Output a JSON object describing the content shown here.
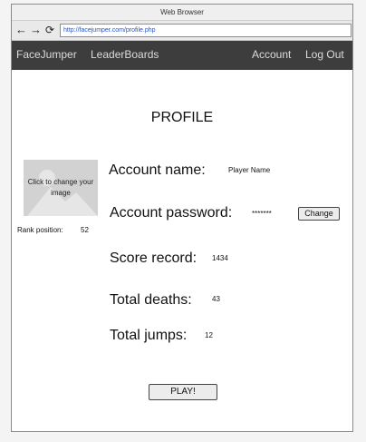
{
  "window": {
    "title": "Web Browser",
    "url": "http://facejumper.com/profile.php"
  },
  "nav": {
    "brand": "FaceJumper",
    "leaderboards": "LeaderBoards",
    "account": "Account",
    "logout": "Log Out"
  },
  "page": {
    "title": "PROFILE"
  },
  "avatar": {
    "prompt": "Click to change your image"
  },
  "rank": {
    "label": "Rank position:",
    "value": "52"
  },
  "fields": {
    "account_name_label": "Account name:",
    "account_name_value": "Player Name",
    "password_label": "Account password:",
    "password_value": "*******",
    "change_button": "Change",
    "score_label": "Score record:",
    "score_value": "1434",
    "deaths_label": "Total deaths:",
    "deaths_value": "43",
    "jumps_label": "Total jumps:",
    "jumps_value": "12"
  },
  "actions": {
    "play_button": "PLAY!"
  },
  "icons": {
    "back": "back-arrow-icon",
    "forward": "forward-arrow-icon",
    "reload": "reload-icon",
    "avatar_placeholder": "image-placeholder-icon"
  },
  "colors": {
    "nav_background": "#3d3d3d",
    "nav_text": "#dcdcdc",
    "url_text": "#2a55c0",
    "avatar_background": "#d2d2d2"
  }
}
